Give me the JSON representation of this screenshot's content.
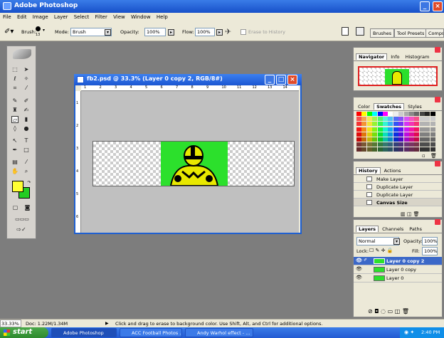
{
  "app": {
    "title": "Adobe Photoshop"
  },
  "menu": [
    "File",
    "Edit",
    "Image",
    "Layer",
    "Select",
    "Filter",
    "View",
    "Window",
    "Help"
  ],
  "options": {
    "brush_label": "Brush:",
    "brush_size": "13",
    "mode_label": "Mode:",
    "mode_value": "Brush",
    "opacity_label": "Opacity:",
    "opacity_value": "100%",
    "flow_label": "Flow:",
    "flow_value": "100%",
    "erase_history_label": "Erase to History",
    "tabs": [
      "Brushes",
      "Tool Presets",
      "Comps"
    ]
  },
  "document": {
    "title": "fb2.psd @ 33.3% (Layer 0 copy 2, RGB/8#)",
    "ruler_marks": [
      "1",
      "2",
      "3",
      "4",
      "5",
      "6",
      "7",
      "8",
      "9",
      "10",
      "11",
      "12",
      "13",
      "14"
    ]
  },
  "navigator": {
    "tabs": [
      "Navigator",
      "Info",
      "Histogram"
    ]
  },
  "swatches": {
    "tabs": [
      "Color",
      "Swatches",
      "Styles"
    ]
  },
  "history": {
    "tabs": [
      "History",
      "Actions"
    ],
    "items": [
      "Make Layer",
      "Duplicate Layer",
      "Duplicate Layer",
      "Canvas Size"
    ]
  },
  "layers": {
    "tabs": [
      "Layers",
      "Channels",
      "Paths"
    ],
    "blend_mode": "Normal",
    "opacity_label": "Opacity:",
    "opacity_value": "100%",
    "lock_label": "Lock:",
    "fill_label": "Fill:",
    "fill_value": "100%",
    "items": [
      "Layer 0 copy 2",
      "Layer 0 copy",
      "Layer 0"
    ]
  },
  "status": {
    "zoom": "33.33%",
    "doc": "Doc: 1.22M/1.34M",
    "hint": "Click and drag to erase to background color.  Use Shift, Alt, and Ctrl for additional options."
  },
  "taskbar": {
    "start": "start",
    "tasks": [
      "Adobe Photoshop",
      "ACC Football Photos ...",
      "Andy Warhol effect - ..."
    ],
    "time": "2:40 PM"
  },
  "colors": {
    "foreground": "#ffff33",
    "background": "#22cc22",
    "photo_bg": "#2ce02c",
    "figure": "#e8e800"
  }
}
